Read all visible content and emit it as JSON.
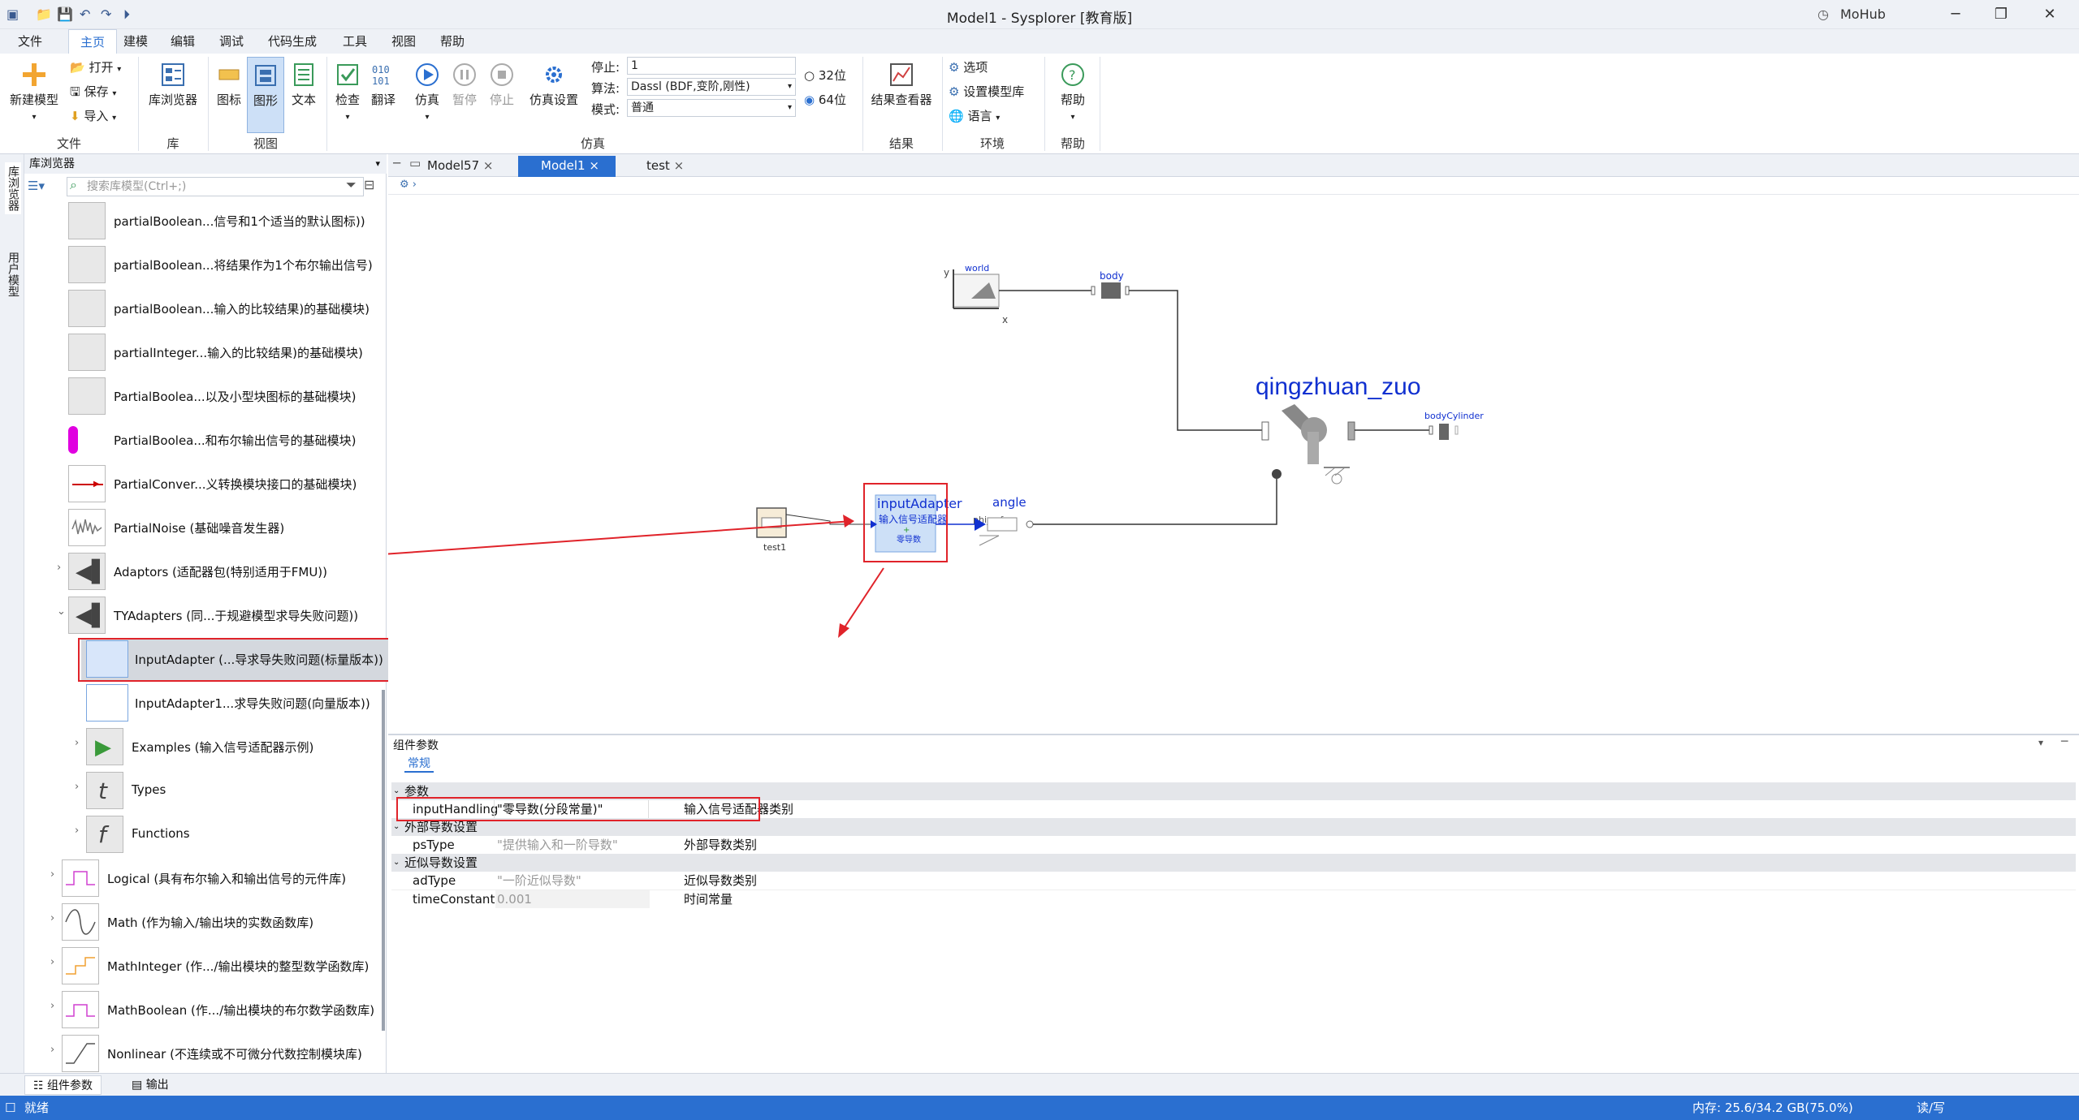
{
  "window": {
    "title": "Model1 - Sysplorer [教育版]",
    "user": "MoHub"
  },
  "menu": [
    "文件",
    "主页",
    "建模",
    "编辑",
    "调试",
    "代码生成",
    "工具",
    "视图",
    "帮助"
  ],
  "search_placeholder": "搜索",
  "ribbon": {
    "new_model": "新建模型",
    "open": "打开",
    "save": "保存",
    "import": "导入",
    "group_file": "文件",
    "lib_browser": "库浏览器",
    "group_lib": "库",
    "icon": "图标",
    "diagram": "图形",
    "text": "文本",
    "group_view": "视图",
    "check": "检查",
    "translate": "翻译",
    "simulate": "仿真",
    "pause": "暂停",
    "stop": "停止",
    "sim_settings": "仿真设置",
    "stop_label": "停止:",
    "stop_value": "1",
    "algo_label": "算法:",
    "algo_value": "Dassl (BDF,变阶,刚性)",
    "mode_label": "模式:",
    "mode_value": "普通",
    "bit32": "32位",
    "bit64": "64位",
    "group_sim": "仿真",
    "result_viewer": "结果查看器",
    "group_result": "结果",
    "options": "选项",
    "set_lib": "设置模型库",
    "language": "语言",
    "group_env": "环境",
    "help": "帮助",
    "group_help": "帮助"
  },
  "left_strip": {
    "lib": "库浏览器",
    "user": "用户模型"
  },
  "library": {
    "header": "库浏览器",
    "search_placeholder": "搜索库模型(Ctrl+;)",
    "items": [
      "partialBoolean...信号和1个适当的默认图标))",
      "partialBoolean...将结果作为1个布尔输出信号)",
      "partialBoolean...输入的比较结果)的基础模块)",
      "partialInteger...输入的比较结果)的基础模块)",
      "PartialBoolea...以及小型块图标的基础模块)",
      "PartialBoolea...和布尔输出信号的基础模块)",
      "PartialConver...义转换模块接口的基础模块)",
      "PartialNoise (基础噪音发生器)",
      "Adaptors (适配器包(特别适用于FMU))",
      "TYAdapters (同...于规避模型求导失败问题))",
      "InputAdapter (...导求导失败问题(标量版本))",
      "InputAdapter1...求导失败问题(向量版本))",
      "Examples (输入信号适配器示例)",
      "Types",
      "Functions",
      "Logical (具有布尔输入和输出信号的元件库)",
      "Math (作为输入/输出块的实数函数库)",
      "MathInteger (作.../输出模块的整型数学函数库)",
      "MathBoolean (作.../输出模块的布尔数学函数库)",
      "Nonlinear (不连续或不可微分代数控制模块库)"
    ]
  },
  "tabs": [
    "Model57",
    "Model1",
    "test"
  ],
  "diagram": {
    "world": "world",
    "body": "body",
    "qingzhuan": "qingzhuan_zuo",
    "bodyCylinder": "bodyCylinder",
    "inputAdapter": "inputAdapter",
    "adapter_cn": "输入信号适配器",
    "adapter_zero": "零导数",
    "angle": "angle",
    "phi_ref": "phi_ref",
    "test1": "test1",
    "axis_x": "x",
    "axis_y": "y"
  },
  "params": {
    "header": "组件参数",
    "tab": "常规",
    "group1": "参数",
    "group2": "外部导数设置",
    "group3": "近似导数设置",
    "rows": [
      {
        "name": "inputHandling",
        "value": "\"零导数(分段常量)\"",
        "desc": "输入信号适配器类别"
      },
      {
        "name": "psType",
        "value": "\"提供输入和一阶导数\"",
        "desc": "外部导数类别"
      },
      {
        "name": "adType",
        "value": "\"一阶近似导数\"",
        "desc": "近似导数类别"
      },
      {
        "name": "timeConstant",
        "value": "0.001",
        "desc": "时间常量"
      }
    ]
  },
  "bottom_tabs": [
    "组件参数",
    "输出"
  ],
  "status": {
    "left": "就绪",
    "memory": "内存: 25.6/34.2 GB(75.0%)",
    "rw": "读/写"
  }
}
